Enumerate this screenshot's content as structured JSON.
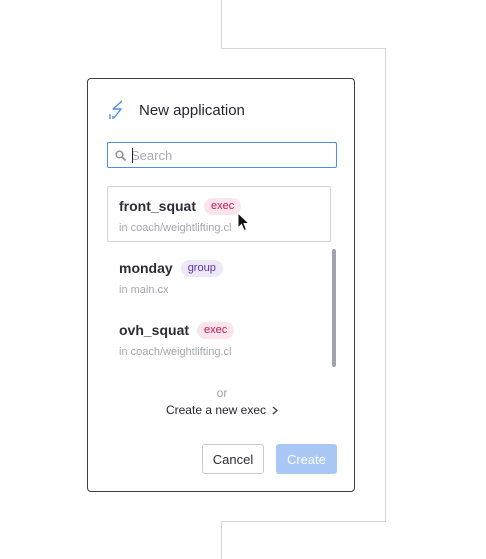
{
  "dialog": {
    "title": "New application",
    "icon": "application-bolt-icon"
  },
  "search": {
    "placeholder": "Search",
    "value": "",
    "icon": "search-icon"
  },
  "applications": [
    {
      "name": "front_squat",
      "type": "exec",
      "path": "in coach/weightlifting.cl",
      "selected": true
    },
    {
      "name": "monday",
      "type": "group",
      "path": "in main.cx",
      "selected": false
    },
    {
      "name": "ovh_squat",
      "type": "exec",
      "path": "in coach/weightlifting.cl",
      "selected": false
    }
  ],
  "footer": {
    "or_label": "or",
    "create_new_label": "Create a new exec",
    "cancel_label": "Cancel",
    "create_label": "Create"
  },
  "colors": {
    "accent": "#4a90e2",
    "create_button_disabled": "#a9c8f5",
    "exec_badge_bg": "#fce4ec",
    "exec_badge_text": "#c2185b",
    "group_badge_bg": "#ede7f6",
    "group_badge_text": "#5e35b1"
  }
}
